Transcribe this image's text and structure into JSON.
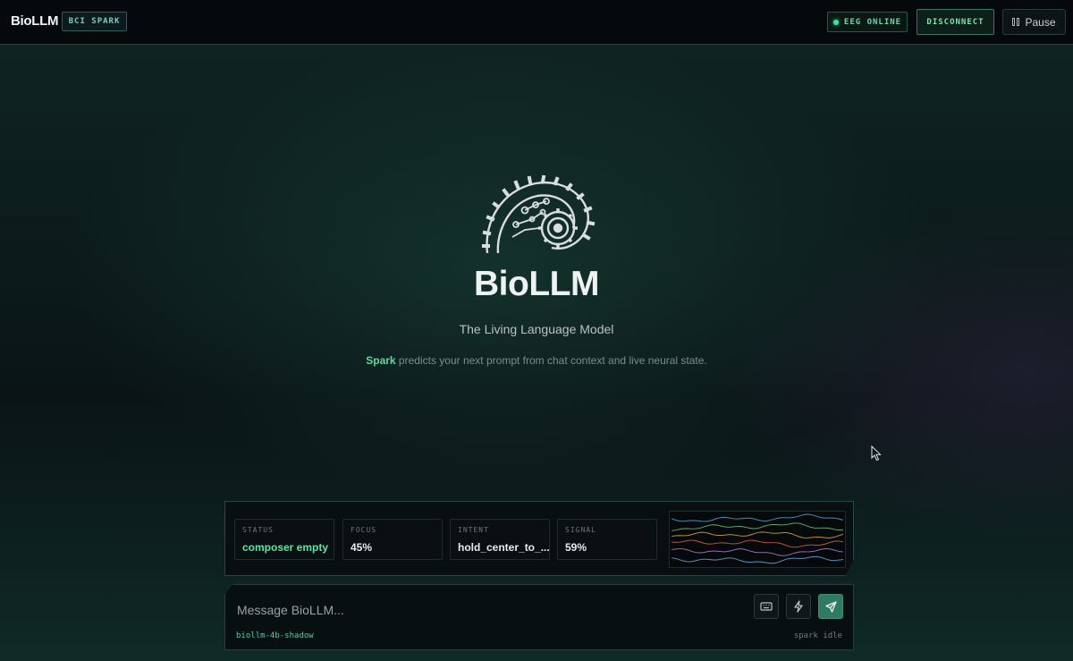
{
  "app": {
    "name": "BioLLM",
    "mode_badge": "BCI SPARK"
  },
  "header": {
    "eeg_status": "EEG ONLINE",
    "disconnect_label": "DISCONNECT",
    "pause_label": "Pause"
  },
  "hero": {
    "title": "BioLLM",
    "subtitle": "The Living Language Model",
    "desc_highlight": "Spark",
    "desc_rest": " predicts your next prompt from chat context and live neural state."
  },
  "telemetry": {
    "tiles": [
      {
        "label": "STATUS",
        "value": "composer empty"
      },
      {
        "label": "FOCUS",
        "value": "45%"
      },
      {
        "label": "INTENT",
        "value": "hold_center_to_..."
      },
      {
        "label": "SIGNAL",
        "value": "59%"
      }
    ],
    "eeg_channels": 6
  },
  "composer": {
    "placeholder": "Message BioLLM...",
    "model": "biollm-4b-shadow",
    "spark_status": "spark idle"
  },
  "icons": {
    "logo": "gear-spiral-logo-icon",
    "pause": "pause-icon",
    "keyboard": "keyboard-icon",
    "spark": "lightning-icon",
    "send": "send-icon"
  },
  "colors": {
    "accent": "#5de3a6",
    "status_online": "#3ee39a",
    "send_button": "#2f7a61",
    "eeg_traces": [
      "#4aa6d8",
      "#6ec37a",
      "#e0a63a",
      "#e0604f",
      "#b07ee0",
      "#5fa9e8"
    ]
  }
}
